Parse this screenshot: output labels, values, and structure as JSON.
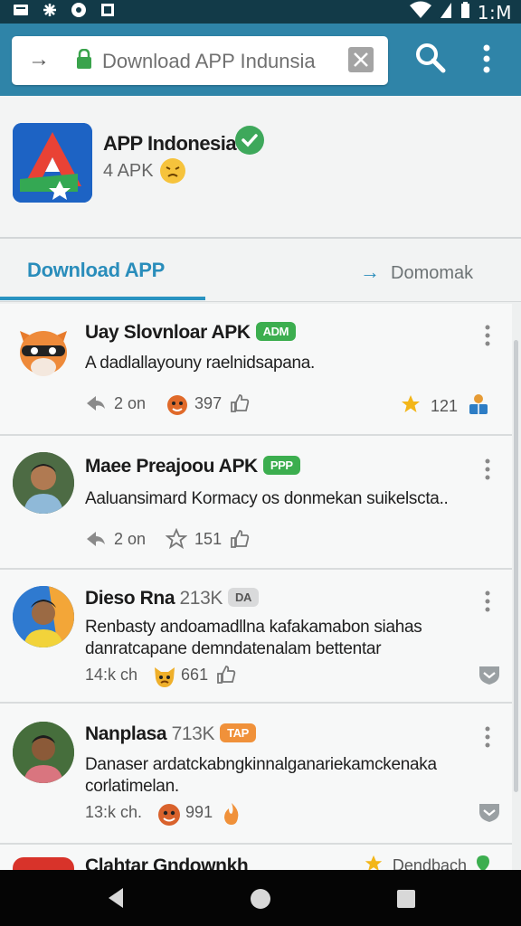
{
  "status_bar": {
    "time": "1:M"
  },
  "toolbar": {
    "url_text": "Download APP Indunsia"
  },
  "app": {
    "name": "APP Indonesia",
    "subtitle": "4 APK"
  },
  "tabs": {
    "active_label": "Download APP",
    "other_label": "Domomak"
  },
  "posts": [
    {
      "title": "Uay Slovnloar APK",
      "badge": "ADM",
      "badge_color": "#3cae4f",
      "body": "A dadlallayouny raelnidsapana.",
      "meta_time": "2 on",
      "meta_count": "397",
      "right_count": "121"
    },
    {
      "title": "Maee Preajoou APK",
      "badge": "PPP",
      "badge_color": "#3cae4f",
      "body": "Aaluansimard Kormacy os donmekan suikelscta..",
      "meta_time": "2 on",
      "meta_count": "151"
    },
    {
      "title": "Dieso Rna",
      "title_muted": "213K",
      "badge": "DA",
      "badge_color": "#d9dadb",
      "body": "Renbasty andoamadllna kafakamabon siahas danratcapane demndatenalam bettentar",
      "meta_time": "14:k ch",
      "meta_count": "661"
    },
    {
      "title": "Nanplasa",
      "title_muted": "713K",
      "badge": "TAP",
      "badge_color": "#f0913a",
      "body": "Danaser ardatckabngkinnalganariekamckenaka corlatimelan.",
      "meta_time": "13:k ch.",
      "meta_count": "991"
    },
    {
      "title": "Clahtar Gndownkh",
      "right_label": "Dendbach"
    }
  ],
  "colors": {
    "toolbar": "#2f84a8",
    "status_bar": "#123a48",
    "accent": "#2a93c1"
  }
}
